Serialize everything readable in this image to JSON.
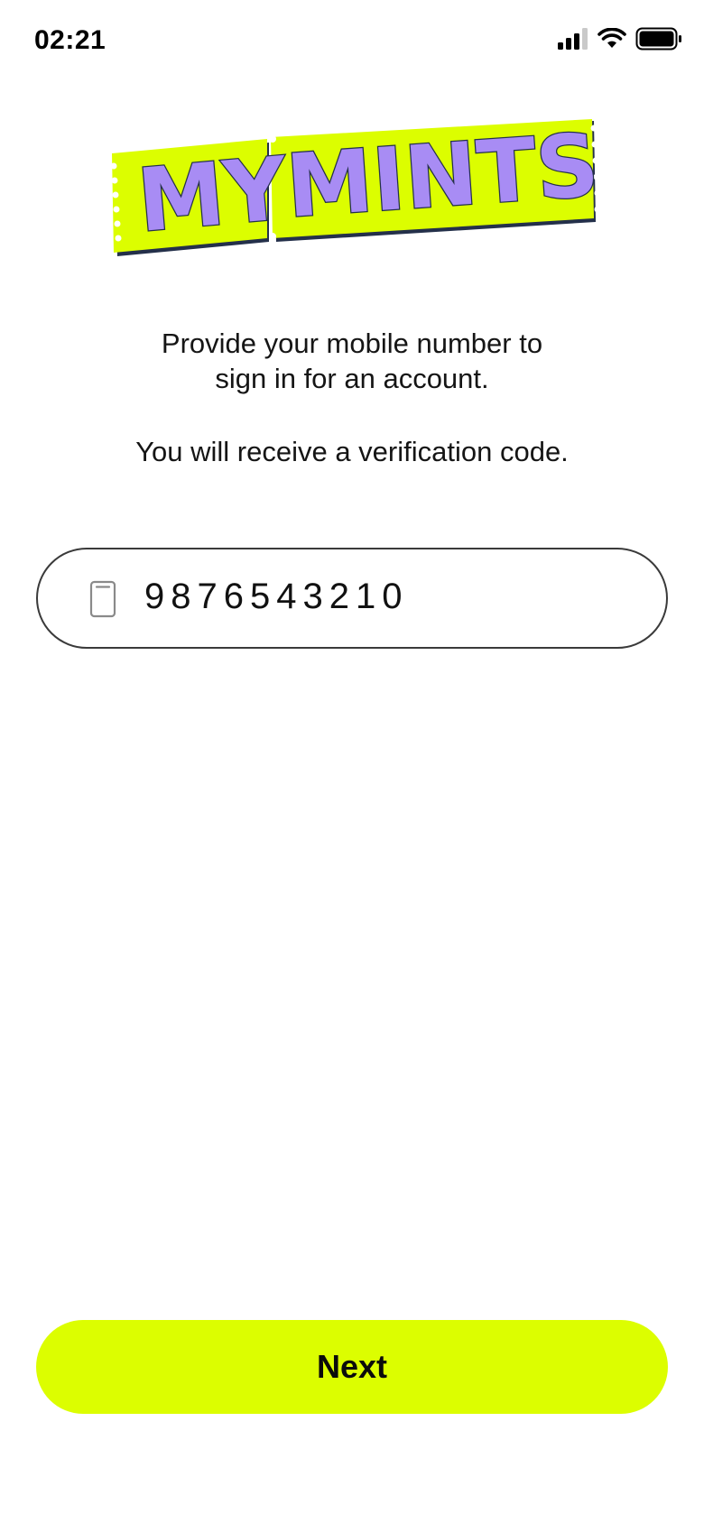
{
  "status_bar": {
    "time": "02:21",
    "icons": [
      "cellular-signal-icon",
      "wifi-icon",
      "battery-icon"
    ]
  },
  "logo": {
    "word1": "MY",
    "word2": "MINTS",
    "colors": {
      "ticket": "#dcfe00",
      "letters": "#a88cf4",
      "outline": "#24304a"
    }
  },
  "instructions": {
    "line1": "Provide your mobile number to",
    "line2": "sign in for an account.",
    "line3": "You will receive a verification code."
  },
  "phone_input": {
    "icon": "mobile-phone-icon",
    "value": "9876543210"
  },
  "next_button": {
    "label": "Next"
  },
  "colors": {
    "accent": "#dcfe00",
    "text": "#111111",
    "border": "#3a3a3a"
  }
}
